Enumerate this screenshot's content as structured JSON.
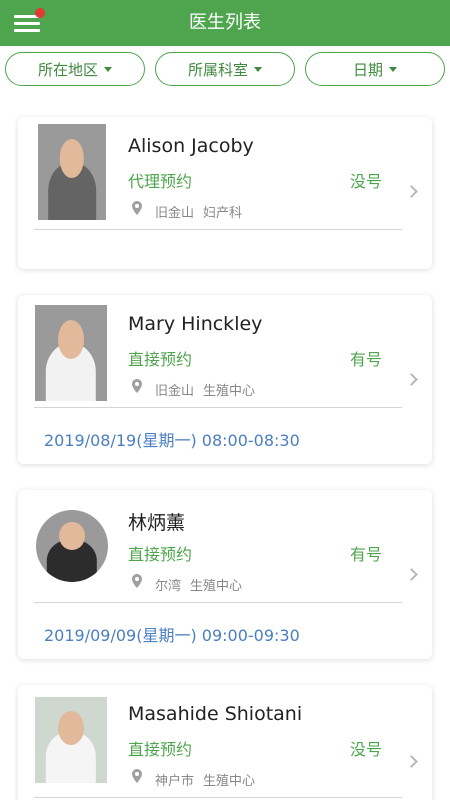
{
  "header": {
    "title": "医生列表",
    "menu_icon": "hamburger-menu-icon",
    "notification_dot_color": "#e53935",
    "bar_color": "#4ea54e"
  },
  "filters": [
    {
      "label": "所在地区"
    },
    {
      "label": "所属科室"
    },
    {
      "label": "日期"
    }
  ],
  "doctors": [
    {
      "name": "Alison Jacoby",
      "appointment_type": "代理预约",
      "availability": "没号",
      "city": "旧金山",
      "department": "妇产科",
      "slot": ""
    },
    {
      "name": "Mary Hinckley",
      "appointment_type": "直接预约",
      "availability": "有号",
      "city": "旧金山",
      "department": "生殖中心",
      "slot": "2019/08/19(星期一) 08:00-08:30"
    },
    {
      "name": "林炳薰",
      "appointment_type": "直接预约",
      "availability": "有号",
      "city": "尔湾",
      "department": "生殖中心",
      "slot": "2019/09/09(星期一) 09:00-09:30"
    },
    {
      "name": "Masahide Shiotani",
      "appointment_type": "直接预约",
      "availability": "没号",
      "city": "神户市",
      "department": "生殖中心",
      "slot": ""
    }
  ],
  "colors": {
    "accent": "#4ea54e",
    "slot_text": "#4a7fc1",
    "muted_text": "#888888"
  }
}
